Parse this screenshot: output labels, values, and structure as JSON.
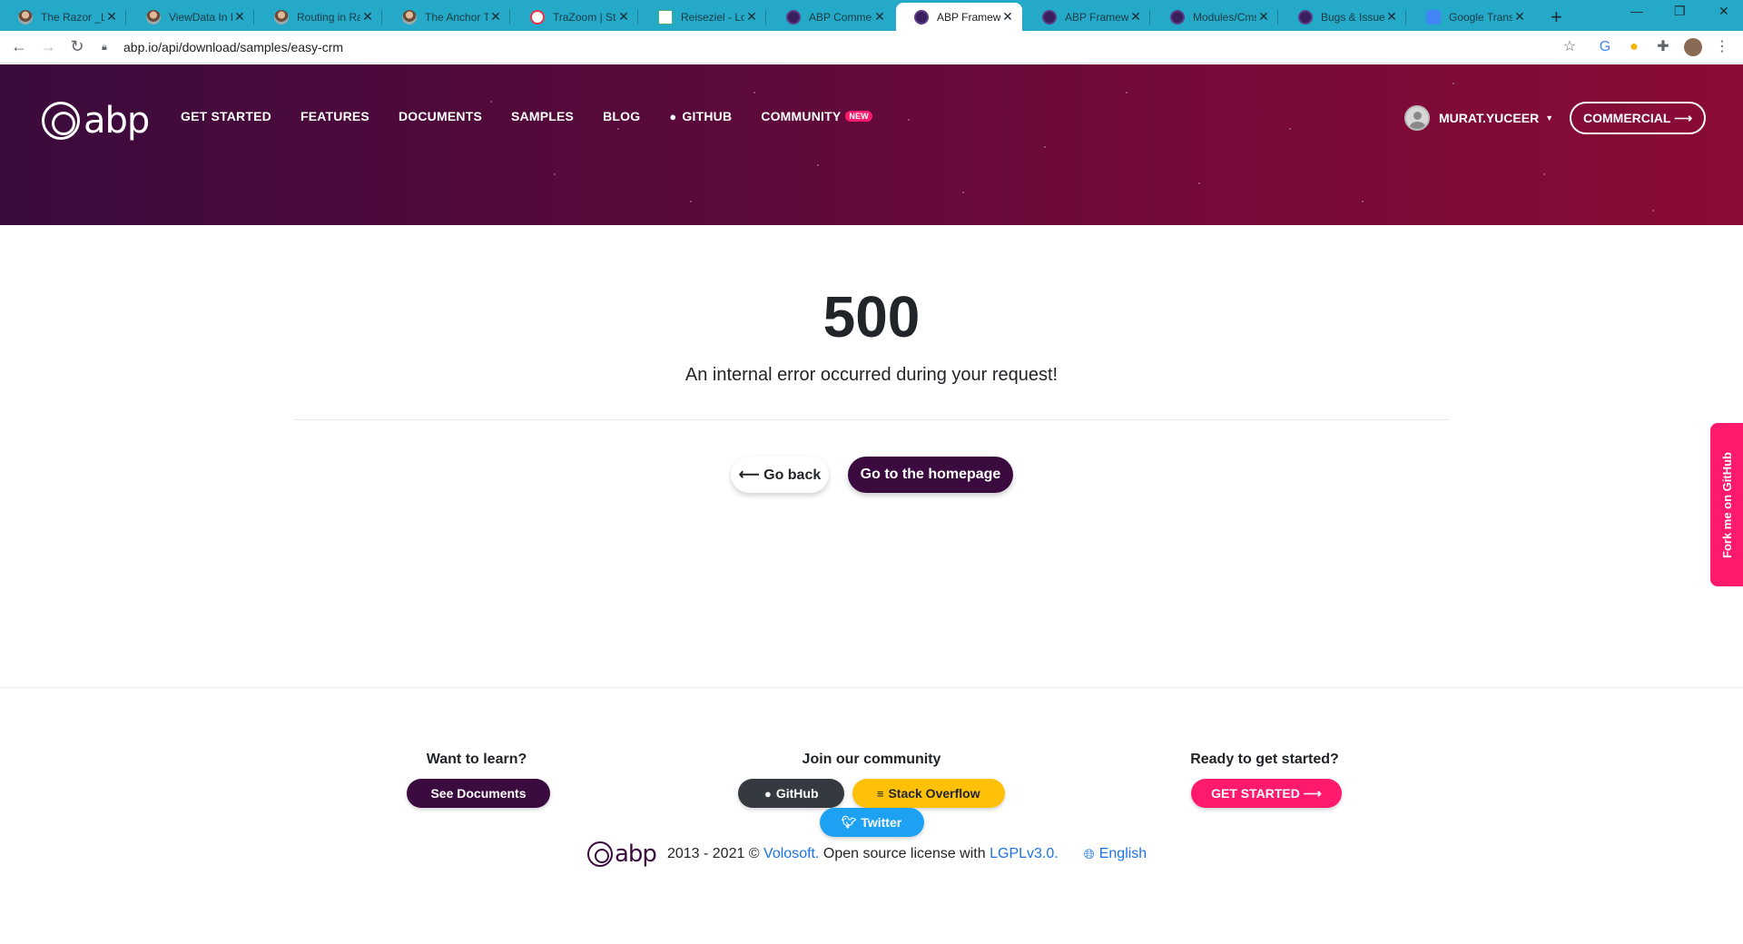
{
  "browser": {
    "tabs": [
      {
        "title": "The Razor _Lay",
        "icon": "person-favicon"
      },
      {
        "title": "ViewData In Ra",
        "icon": "person-favicon"
      },
      {
        "title": "Routing in Razo",
        "icon": "person-favicon"
      },
      {
        "title": "The Anchor Tag",
        "icon": "person-favicon"
      },
      {
        "title": "TraZoom | Stern",
        "icon": "globe-favicon"
      },
      {
        "title": "Reiseziel - Loca",
        "icon": "doc-favicon"
      },
      {
        "title": "ABP Commercia",
        "icon": "abp-favicon"
      },
      {
        "title": "ABP Framewor",
        "icon": "abp-favicon"
      },
      {
        "title": "ABP Framewor",
        "icon": "abp-favicon"
      },
      {
        "title": "Modules/Cms",
        "icon": "abp-favicon"
      },
      {
        "title": "Bugs & Issues",
        "icon": "abp-favicon"
      },
      {
        "title": "Google Transla",
        "icon": "translate-favicon"
      }
    ],
    "active_tab_index": 7,
    "url": "abp.io/api/download/samples/easy-crm"
  },
  "header": {
    "logo_text": "abp",
    "nav": [
      {
        "label": "GET STARTED"
      },
      {
        "label": "FEATURES"
      },
      {
        "label": "DOCUMENTS"
      },
      {
        "label": "SAMPLES"
      },
      {
        "label": "BLOG"
      },
      {
        "label": "GITHUB",
        "icon": "github-icon"
      },
      {
        "label": "COMMUNITY",
        "badge": "NEW"
      }
    ],
    "user_name": "MURAT.YUCEER",
    "commercial_label": "COMMERCIAL ⟶"
  },
  "main": {
    "error_code": "500",
    "error_message": "An internal error occurred during your request!",
    "go_back_label": "⟵ Go back",
    "home_label": "Go to the homepage",
    "fork_label": "Fork me on GitHub"
  },
  "footer": {
    "learn_heading": "Want to learn?",
    "docs_label": "See Documents",
    "community_heading": "Join our community",
    "github_label": "GitHub",
    "stackoverflow_label": "Stack Overflow",
    "twitter_label": "Twitter",
    "start_heading": "Ready to get started?",
    "get_started_label": "GET STARTED ⟶",
    "logo_text": "abp",
    "copyright_prefix": "2013 - 2021 ©",
    "volosoft": "Volosoft.",
    "license_text": "Open source license with",
    "license_link": "LGPLv3.0.",
    "language": "English"
  },
  "colors": {
    "brand": "#3b0b3f",
    "accent": "#ff1a6e",
    "tabstrip": "#25a9c8"
  }
}
